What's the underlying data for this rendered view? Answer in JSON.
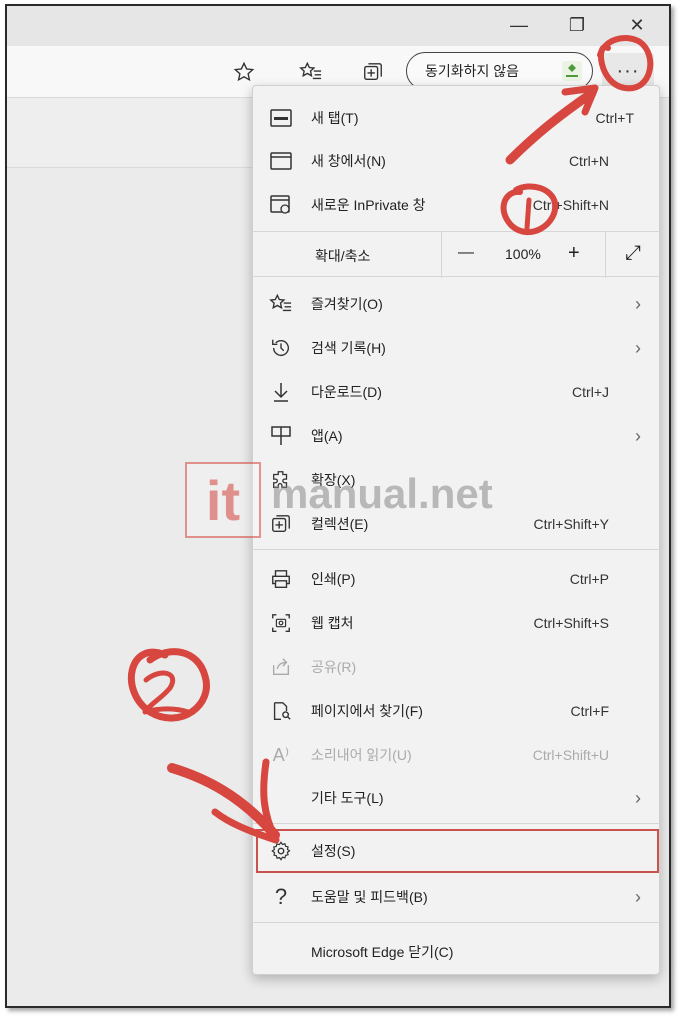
{
  "window": {
    "minimize": "—",
    "restore": "❐",
    "close": "✕"
  },
  "toolbar": {
    "favorite_icon": "star-outline-icon",
    "favorites_list_icon": "favorites-icon",
    "collections_icon": "collections-icon",
    "sync_label": "동기화하지 않음",
    "more_label": "···"
  },
  "menu": {
    "items": [
      {
        "label": "새 탭(T)",
        "shortcut": "Ctrl+T",
        "icon": "new-tab-icon"
      },
      {
        "label": "새 창에서(N)",
        "shortcut": "Ctrl+N",
        "icon": "new-window-icon"
      },
      {
        "label": "새로운 InPrivate 창",
        "shortcut": "Ctrl+Shift+N",
        "icon": "inprivate-icon"
      }
    ],
    "zoom": {
      "label": "확대/축소",
      "minus": "—",
      "value": "100%",
      "plus": "+",
      "expand": "⤢"
    },
    "items2": [
      {
        "label": "즐겨찾기(O)",
        "shortcut": "",
        "icon": "favorites-icon"
      },
      {
        "label": "검색 기록(H)",
        "shortcut": "",
        "icon": "history-icon"
      },
      {
        "label": "다운로드(D)",
        "shortcut": "Ctrl+J",
        "icon": "download-icon"
      },
      {
        "label": "앱(A)",
        "shortcut": "",
        "icon": "apps-icon"
      },
      {
        "label": "확장(X)",
        "shortcut": "",
        "icon": "extensions-icon"
      },
      {
        "label": "컬렉션(E)",
        "shortcut": "Ctrl+Shift+Y",
        "icon": "collections-icon"
      }
    ],
    "items3": [
      {
        "label": "인쇄(P)",
        "shortcut": "Ctrl+P",
        "icon": "print-icon"
      },
      {
        "label": "웹 캡처",
        "shortcut": "Ctrl+Shift+S",
        "icon": "web-capture-icon"
      },
      {
        "label": "공유(R)",
        "shortcut": "",
        "icon": "share-icon"
      },
      {
        "label": "페이지에서 찾기(F)",
        "shortcut": "Ctrl+F",
        "icon": "find-icon"
      },
      {
        "label": "소리내어 읽기(U)",
        "shortcut": "Ctrl+Shift+U",
        "icon": "read-aloud-icon"
      },
      {
        "label": "기타 도구(L)",
        "shortcut": "",
        "icon": ""
      }
    ],
    "settings": {
      "label": "설정(S)",
      "icon": "gear-icon"
    },
    "help": {
      "label": "도움말 및 피드백(B)",
      "icon": "help-icon"
    },
    "close_edge": {
      "label": "Microsoft Edge 닫기(C)"
    }
  },
  "watermark": {
    "box": "it",
    "text": "manual.net"
  },
  "annotations": {
    "color": "#d7463f"
  }
}
